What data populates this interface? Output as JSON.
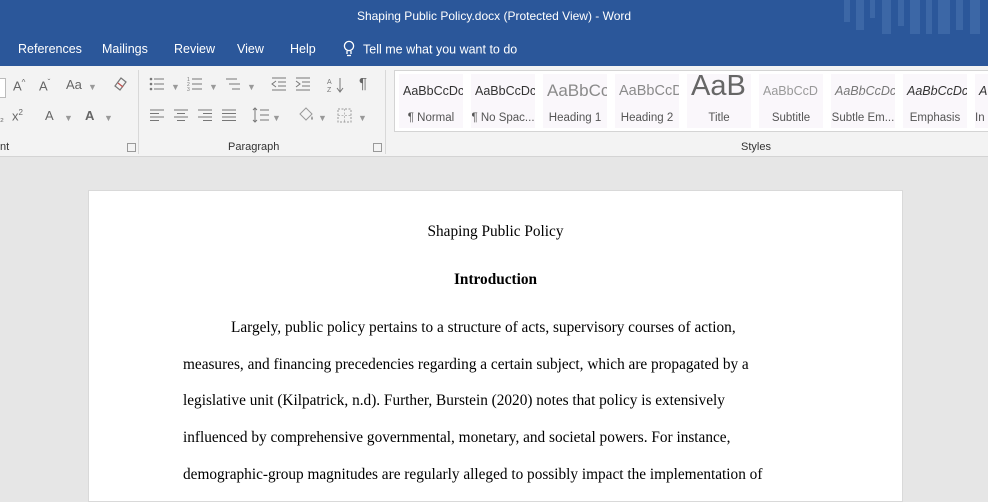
{
  "window": {
    "title": "Shaping Public Policy.docx (Protected View)  -  Word"
  },
  "menu": {
    "tabs": [
      "References",
      "Mailings",
      "Review",
      "View",
      "Help"
    ],
    "tell_me": "Tell me what you want to do"
  },
  "ribbon": {
    "groups": {
      "font_partial": "nt",
      "paragraph": "Paragraph",
      "styles": "Styles"
    },
    "styles": [
      {
        "preview": "AaBbCcDc",
        "label": "¶ Normal"
      },
      {
        "preview": "AaBbCcDc",
        "label": "¶ No Spac..."
      },
      {
        "preview": "AaBbCc",
        "label": "Heading 1"
      },
      {
        "preview": "AaBbCcD",
        "label": "Heading 2"
      },
      {
        "preview": "AaB",
        "label": "Title"
      },
      {
        "preview": "AaBbCcD",
        "label": "Subtitle"
      },
      {
        "preview": "AaBbCcDc",
        "label": "Subtle Em..."
      },
      {
        "preview": "AaBbCcDc",
        "label": "Emphasis"
      },
      {
        "preview": "A",
        "label": "In"
      }
    ]
  },
  "document": {
    "title": "Shaping Public Policy",
    "heading": "Introduction",
    "lines": [
      "Largely, public policy pertains to a structure of acts, supervisory courses of action,",
      "measures, and financing precedencies regarding a certain subject, which are propagated by a",
      "legislative unit (Kilpatrick, n.d). Further, Burstein (2020) notes that policy is extensively",
      "influenced by comprehensive governmental, monetary, and societal powers. For instance,",
      "demographic-group magnitudes are regularly alleged to possibly impact the implementation of"
    ]
  },
  "colors": {
    "accent": "#2b579a",
    "ribbon_bg": "#f3f3f3",
    "canvas_bg": "#e6e6e6"
  }
}
